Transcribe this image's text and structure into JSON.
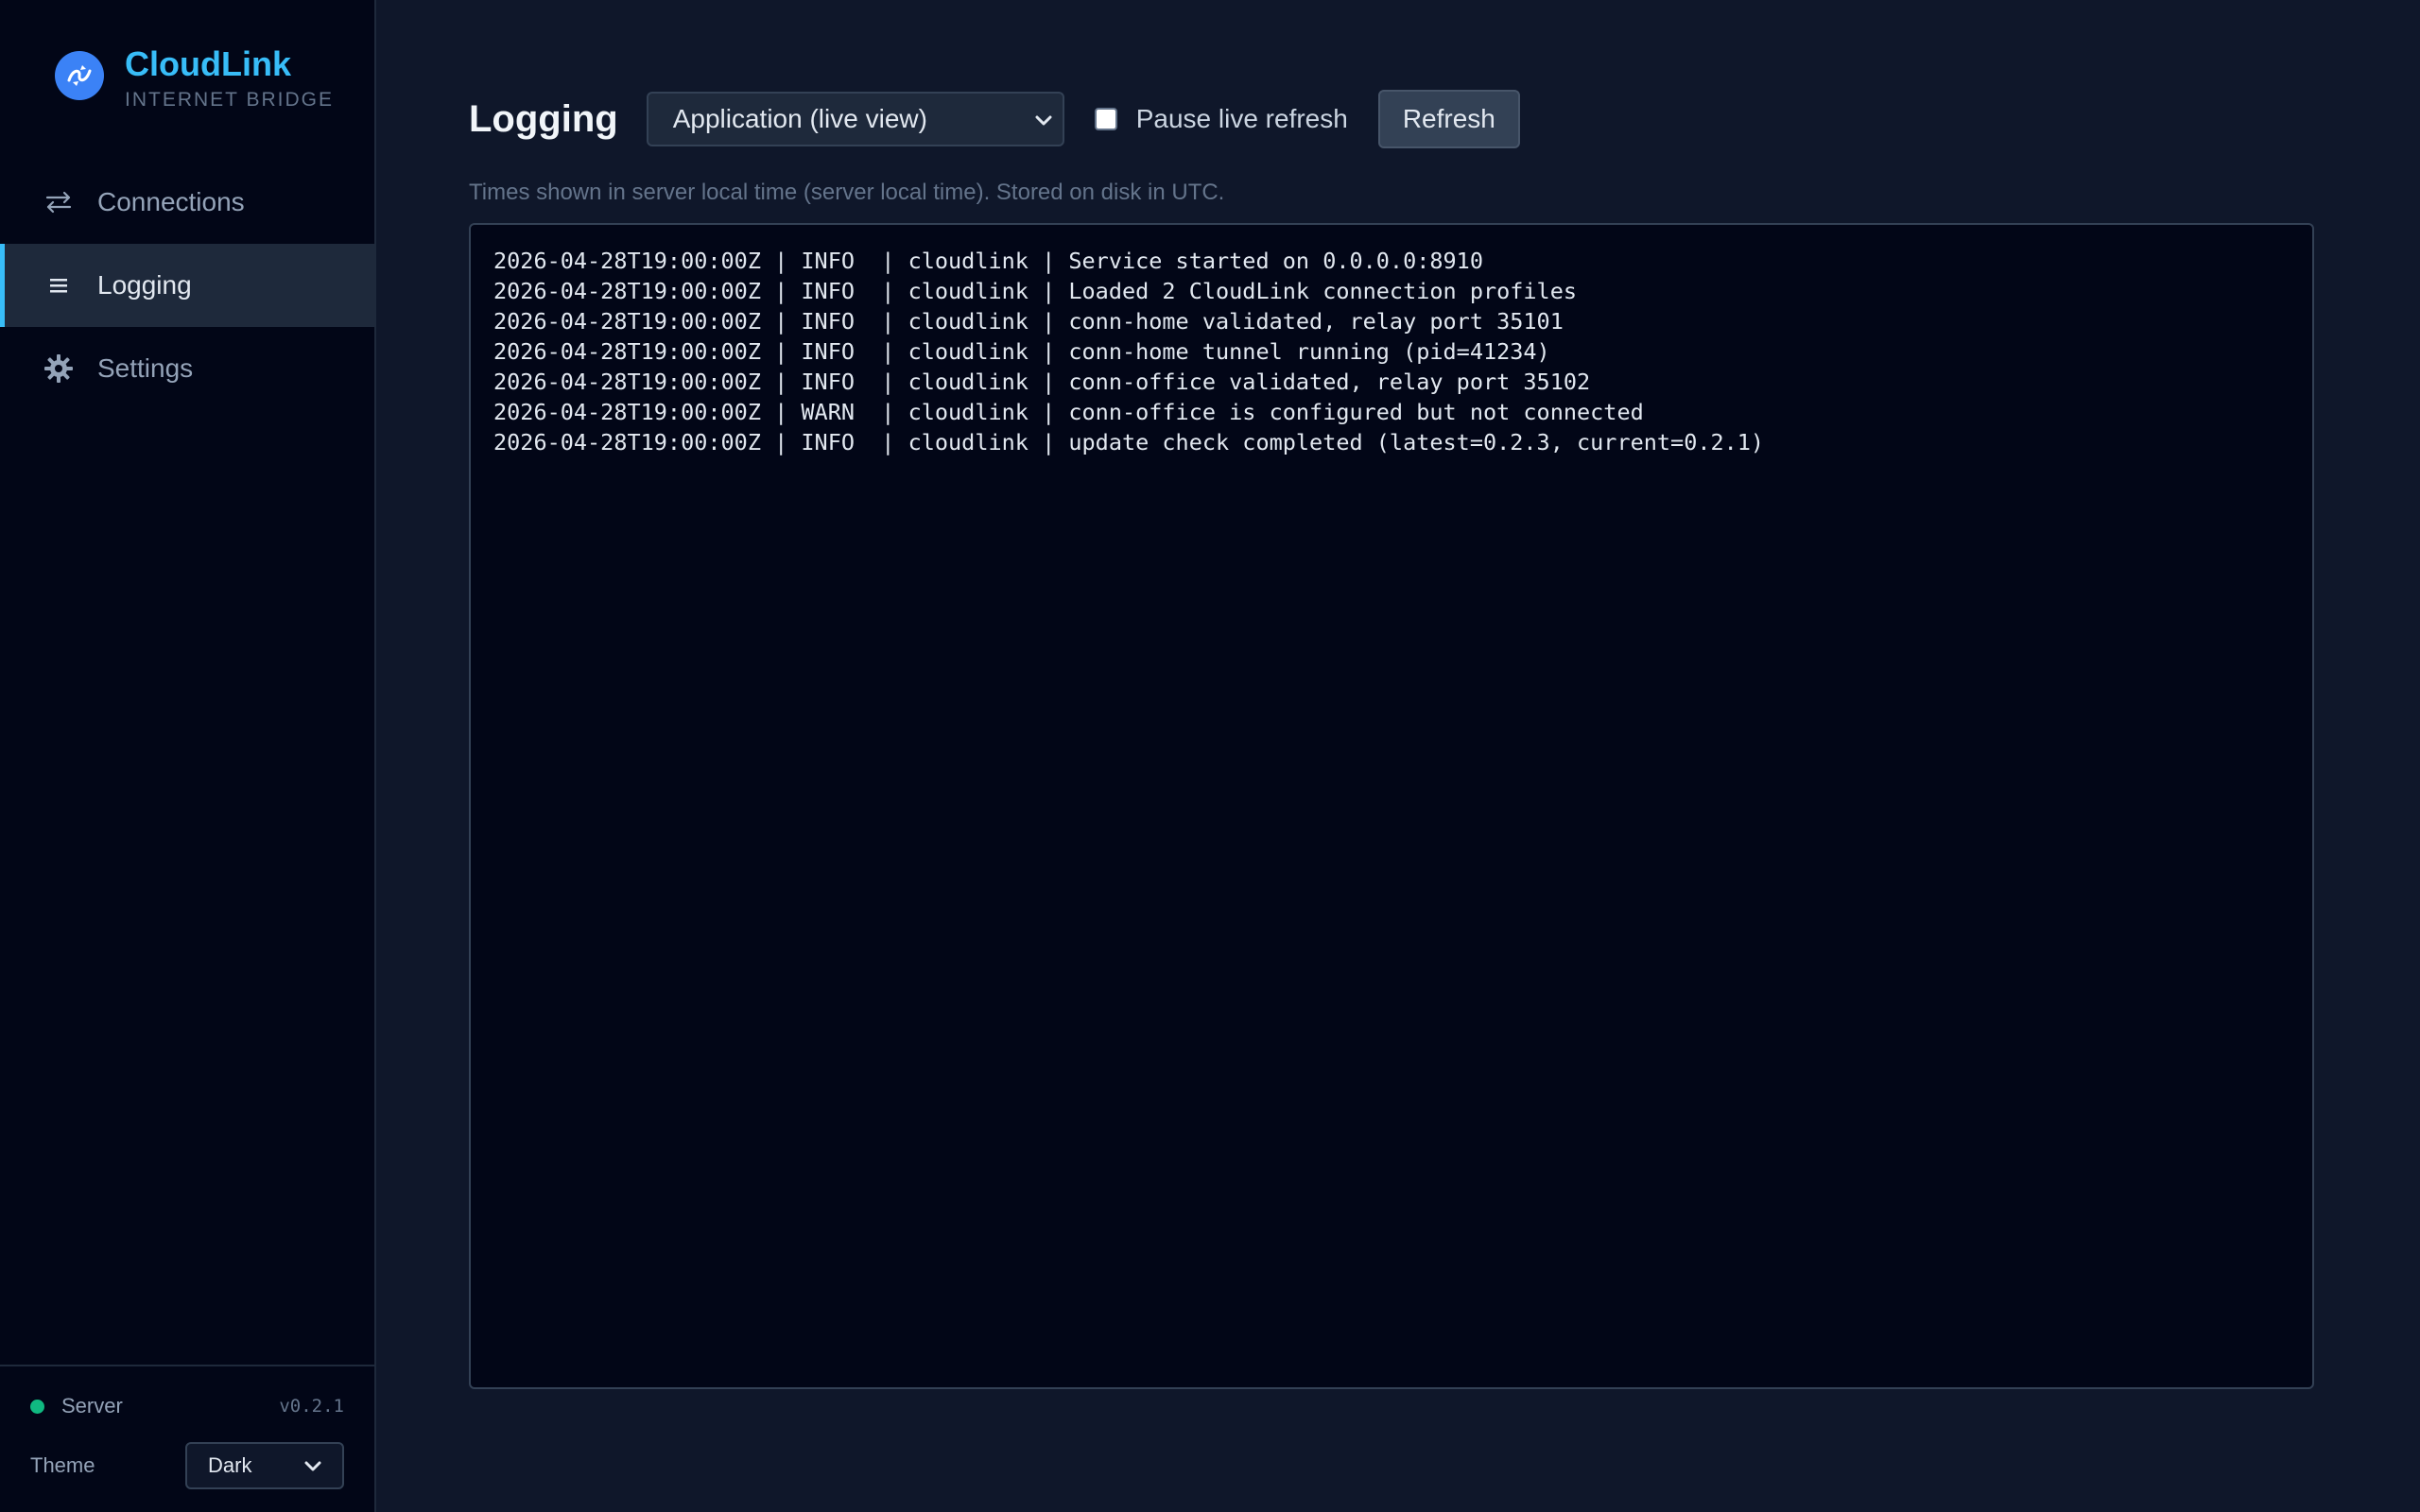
{
  "brand": {
    "title": "CloudLink",
    "subtitle": "INTERNET BRIDGE",
    "logo_icon": "cloudlink-logo-icon"
  },
  "sidebar": {
    "items": [
      {
        "label": "Connections",
        "icon": "swap-arrows-icon",
        "active": false
      },
      {
        "label": "Logging",
        "icon": "list-icon",
        "active": true
      },
      {
        "label": "Settings",
        "icon": "gear-icon",
        "active": false
      }
    ],
    "footer": {
      "server_label": "Server",
      "server_status_color": "#10b981",
      "version": "v0.2.1",
      "theme_label": "Theme",
      "theme_value": "Dark"
    }
  },
  "main": {
    "title": "Logging",
    "log_source": "Application (live view)",
    "pause_label": "Pause live refresh",
    "pause_checked": false,
    "refresh_label": "Refresh",
    "timezone_note": "Times shown in server local time (server local time). Stored on disk in UTC.",
    "log_lines": [
      "2026-04-28T19:00:00Z | INFO  | cloudlink | Service started on 0.0.0.0:8910",
      "2026-04-28T19:00:00Z | INFO  | cloudlink | Loaded 2 CloudLink connection profiles",
      "2026-04-28T19:00:00Z | INFO  | cloudlink | conn-home validated, relay port 35101",
      "2026-04-28T19:00:00Z | INFO  | cloudlink | conn-home tunnel running (pid=41234)",
      "2026-04-28T19:00:00Z | INFO  | cloudlink | conn-office validated, relay port 35102",
      "2026-04-28T19:00:00Z | WARN  | cloudlink | conn-office is configured but not connected",
      "2026-04-28T19:00:00Z | INFO  | cloudlink | update check completed (latest=0.2.3, current=0.2.1)"
    ]
  },
  "colors": {
    "accent": "#38bdf8",
    "sidebar_bg": "#020617",
    "main_bg": "#0f172a"
  }
}
